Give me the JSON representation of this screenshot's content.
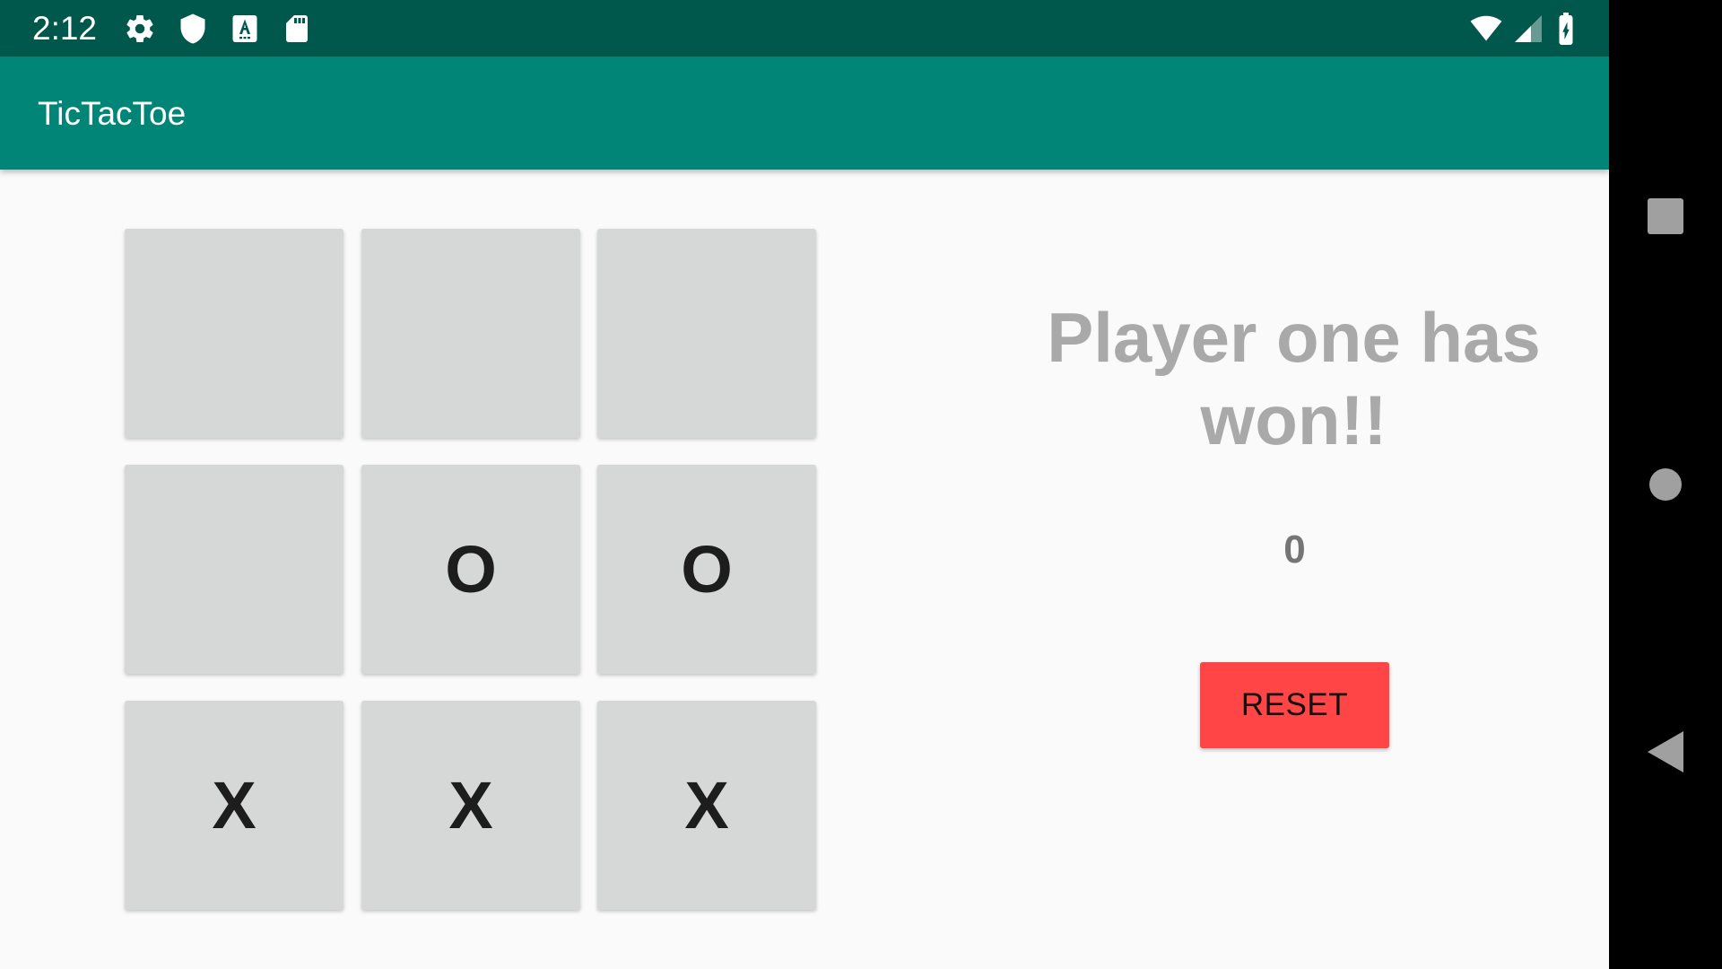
{
  "status_bar": {
    "time": "2:12",
    "icons": [
      "settings-gear-icon",
      "shield-icon",
      "keyboard-a-icon",
      "sd-card-icon",
      "wifi-icon",
      "cell-signal-icon",
      "battery-charging-icon"
    ]
  },
  "app_bar": {
    "title": "TicTacToe"
  },
  "board": {
    "cells": [
      "",
      "",
      "",
      "",
      "O",
      "O",
      "X",
      "X",
      "X"
    ]
  },
  "game": {
    "message": "Player one has won!!",
    "score": "0",
    "reset_label": "RESET"
  },
  "nav_bar": {
    "buttons": [
      "recents-square-icon",
      "home-circle-icon",
      "back-triangle-icon"
    ]
  },
  "colors": {
    "status_bar": "#00574b",
    "app_bar": "#008577",
    "cell": "#d6d7d7",
    "reset_button": "#ff4545",
    "message_text": "#a9a9a9"
  }
}
